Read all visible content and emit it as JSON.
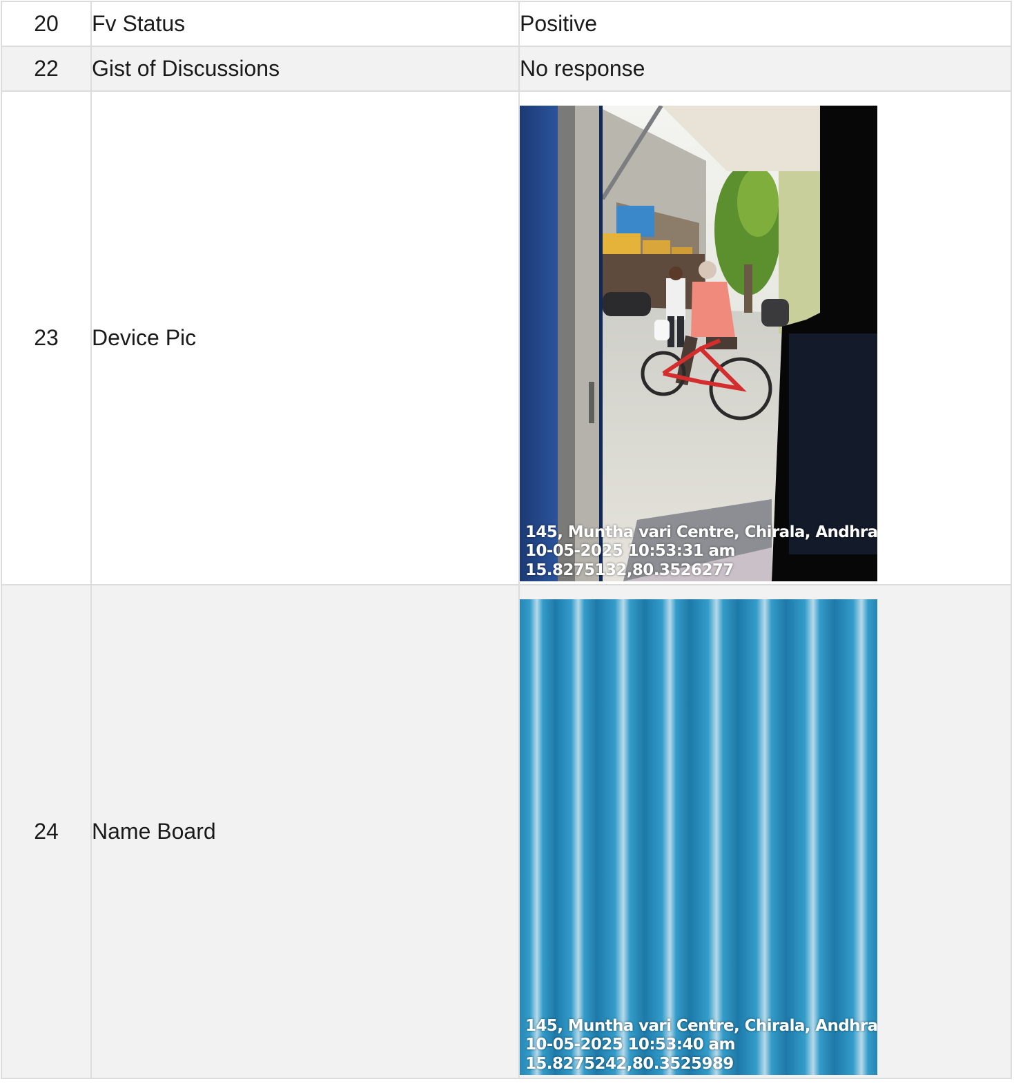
{
  "rows": [
    {
      "num": "20",
      "label": "Fv Status",
      "value": "Positive"
    },
    {
      "num": "22",
      "label": "Gist of Discussions",
      "value": "No response"
    },
    {
      "num": "23",
      "label": "Device Pic",
      "photo": {
        "subject": "street scene with cyclist viewed through shop door",
        "stamp": {
          "address": "145, Muntha vari Centre, Chirala, Andhra ...",
          "datetime": "10-05-2025 10:53:31 am",
          "coords": "15.8275132,80.3526277"
        }
      }
    },
    {
      "num": "24",
      "label": "Name Board",
      "photo": {
        "subject": "close-up of blue corrugated sheet",
        "stamp": {
          "address": "145, Muntha vari Centre, Chirala, Andhra ...",
          "datetime": "10-05-2025 10:53:40 am",
          "coords": "15.8275242,80.3525989"
        }
      }
    }
  ],
  "colors": {
    "border": "#dcdcdc",
    "row_alt": "#f2f2f2",
    "text": "#1a1a1a"
  }
}
